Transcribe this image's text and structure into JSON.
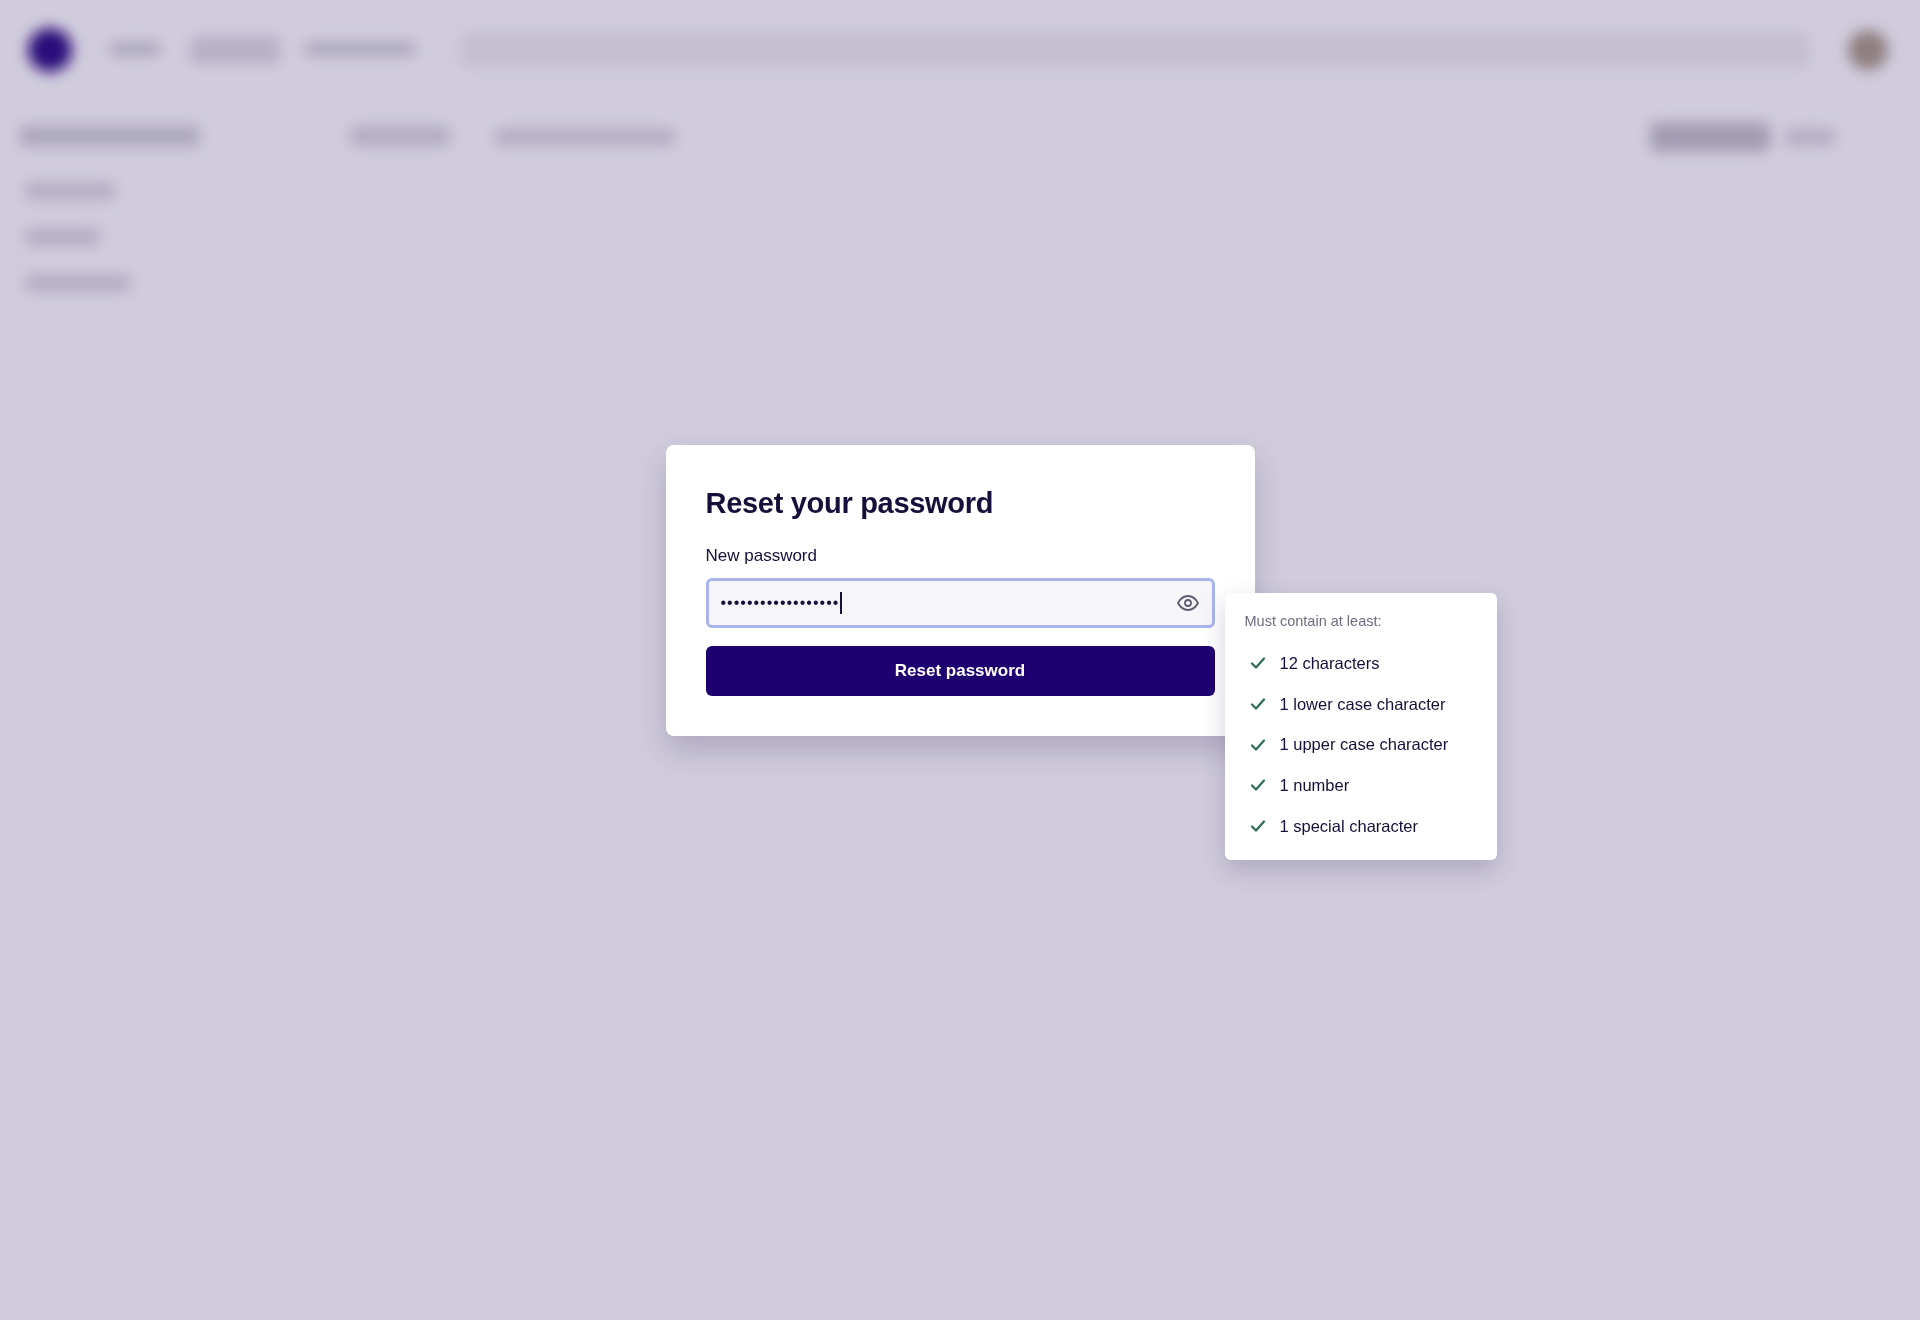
{
  "dialog": {
    "title": "Reset your password",
    "field": {
      "label": "New password",
      "value": "••••••••••••••••••",
      "focused": true
    },
    "button": "Reset password"
  },
  "requirements_popover": {
    "heading": "Must contain at least:",
    "items": [
      {
        "label": "12 characters",
        "met": true
      },
      {
        "label": "1 lower case character",
        "met": true
      },
      {
        "label": "1 upper case character",
        "met": true
      },
      {
        "label": "1 number",
        "met": true
      },
      {
        "label": "1 special character",
        "met": true
      }
    ]
  }
}
